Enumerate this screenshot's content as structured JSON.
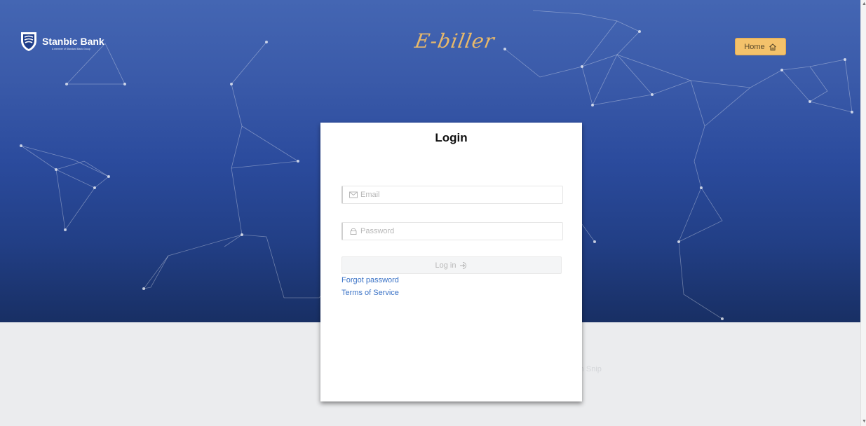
{
  "brand": {
    "name": "Stanbic Bank",
    "tagline": "A member of Standard Bank Group",
    "app_name": "E-biller"
  },
  "header": {
    "home_label": "Home"
  },
  "login": {
    "title": "Login",
    "email_placeholder": "Email",
    "password_placeholder": "Password",
    "submit_label": "Log in",
    "forgot_password": "Forgot password",
    "terms": "Terms of Service"
  },
  "overlay": {
    "snip_label": "Full screen Snip"
  },
  "colors": {
    "hero_top": "#4466b3",
    "hero_bottom": "#182f64",
    "accent_gold": "#f4c26b",
    "link_blue": "#3a72c6"
  },
  "icons": {
    "logo": "shield-icon",
    "home": "home-icon",
    "email": "envelope-icon",
    "password": "lock-icon",
    "login": "sign-in-icon"
  }
}
